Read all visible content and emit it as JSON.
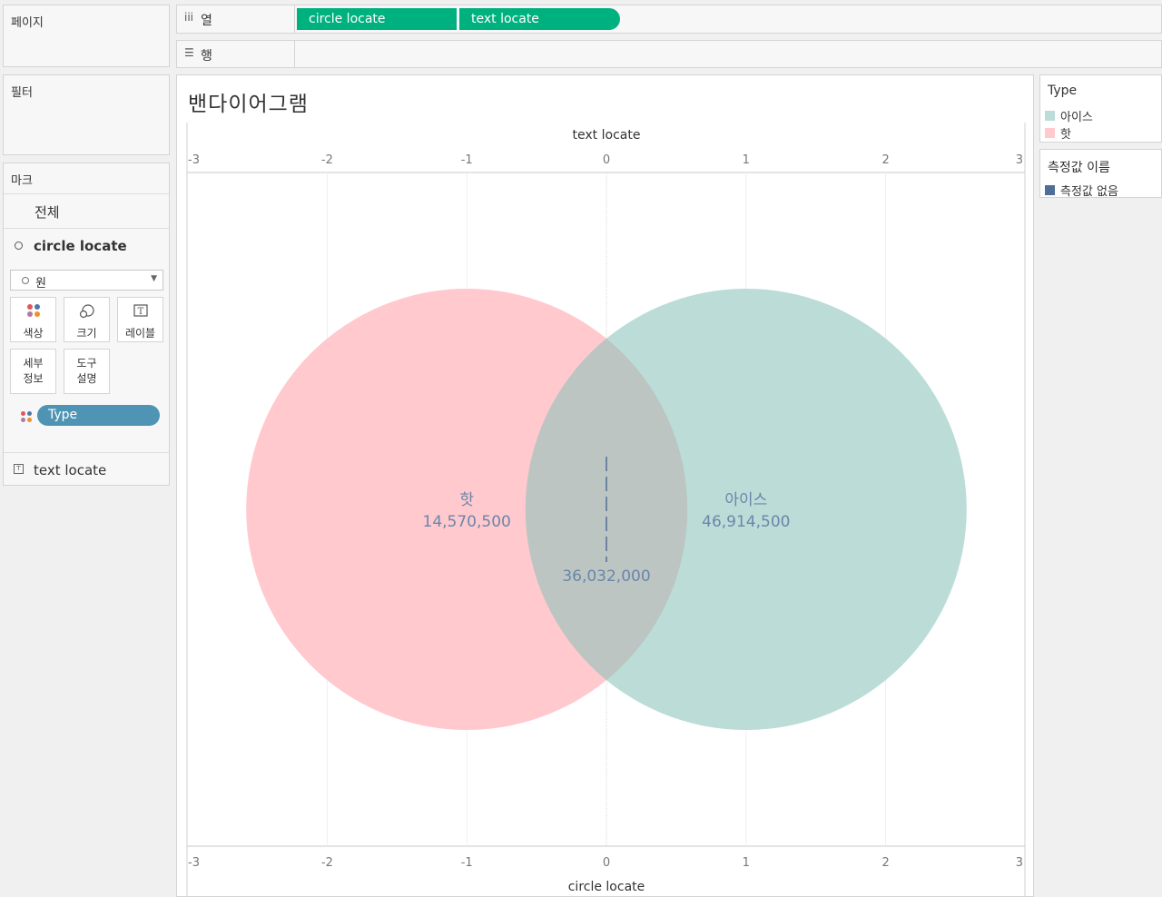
{
  "sidebar": {
    "pages_title": "페이지",
    "filters_title": "필터",
    "marks": {
      "title": "마크",
      "all_label": "전체",
      "layer_circle": "circle locate",
      "mark_type": "원",
      "buttons": {
        "color": "색상",
        "size": "크기",
        "label": "레이블",
        "detail_line1": "세부",
        "detail_line2": "정보",
        "tooltip_line1": "도구",
        "tooltip_line2": "설명"
      },
      "type_pill": "Type",
      "layer_text": "text locate"
    }
  },
  "shelves": {
    "columns": {
      "label": "열",
      "pills": [
        "circle locate",
        "text locate"
      ]
    },
    "rows": {
      "label": "행"
    }
  },
  "viz": {
    "title": "밴다이어그램"
  },
  "legend_type": {
    "title": "Type",
    "items": [
      {
        "label": "아이스",
        "color": "#bcdcd8"
      },
      {
        "label": "핫",
        "color": "#ffc9ce"
      }
    ]
  },
  "legend_measure": {
    "title": "측정값 이름",
    "items": [
      {
        "label": "측정값 없음",
        "color": "#4e6e98"
      }
    ]
  },
  "chart_data": {
    "type": "scatter",
    "title": "",
    "x_top_label": "text locate",
    "x_bottom_label": "circle locate",
    "xlim": [
      -3,
      3
    ],
    "ticks": [
      -3,
      -2,
      -1,
      0,
      1,
      2,
      3
    ],
    "colors": {
      "hot": "#ffc9ce",
      "ice": "#bcdcd8",
      "label": "#6a86aa",
      "line": "#4e6e98"
    },
    "circles": [
      {
        "name": "핫",
        "x": -1,
        "radius": 1.58
      },
      {
        "name": "아이스",
        "x": 1,
        "radius": 1.58
      }
    ],
    "labels": [
      {
        "x": -1,
        "row": 0,
        "name": "핫",
        "value": "14,570,500"
      },
      {
        "x": 1,
        "row": 0,
        "name": "아이스",
        "value": "46,914,500"
      },
      {
        "x": 0,
        "row": 1,
        "name": "",
        "value": "36,032,000"
      }
    ]
  }
}
